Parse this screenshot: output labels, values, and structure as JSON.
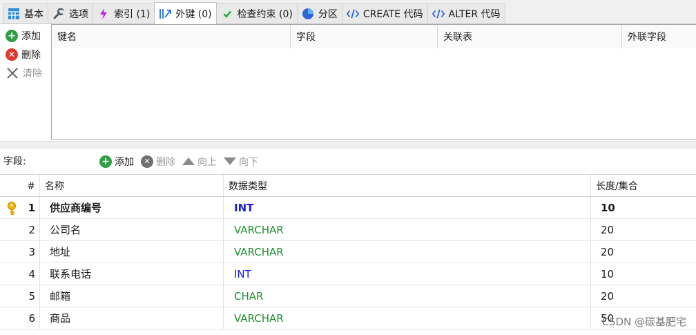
{
  "tabs": [
    {
      "label": "基本",
      "icon": "table-grid-icon"
    },
    {
      "label": "选项",
      "icon": "wrench-icon"
    },
    {
      "label": "索引 (1)",
      "icon": "lightning-icon"
    },
    {
      "label": "外键 (0)",
      "icon": "foreign-key-icon",
      "active": true
    },
    {
      "label": "检查约束 (0)",
      "icon": "check-icon"
    },
    {
      "label": "分区",
      "icon": "pie-icon"
    },
    {
      "label": "CREATE 代码",
      "icon": "code-icon"
    },
    {
      "label": "ALTER 代码",
      "icon": "code-icon"
    }
  ],
  "fk_actions": {
    "add": "添加",
    "delete": "删除",
    "clear": "清除"
  },
  "fk_columns": [
    "键名",
    "字段",
    "关联表",
    "外联字段"
  ],
  "fields_toolbar": {
    "label": "字段:",
    "add": "添加",
    "delete": "删除",
    "up": "向上",
    "down": "向下"
  },
  "field_columns": {
    "num": "#",
    "name": "名称",
    "type": "数据类型",
    "length": "长度/集合"
  },
  "fields": [
    {
      "num": "1",
      "name": "供应商编号",
      "type": "INT",
      "length": "10",
      "primary": true
    },
    {
      "num": "2",
      "name": "公司名",
      "type": "VARCHAR",
      "length": "20"
    },
    {
      "num": "3",
      "name": "地址",
      "type": "VARCHAR",
      "length": "20"
    },
    {
      "num": "4",
      "name": "联系电话",
      "type": "INT",
      "length": "10"
    },
    {
      "num": "5",
      "name": "邮箱",
      "type": "CHAR",
      "length": "20"
    },
    {
      "num": "6",
      "name": "商品",
      "type": "VARCHAR",
      "length": "50"
    }
  ],
  "type_colors": {
    "INT": "#1a1ad6",
    "VARCHAR": "#1e8f2e",
    "CHAR": "#1e8f2e"
  },
  "watermark": "CSDN @碳基肥宅"
}
